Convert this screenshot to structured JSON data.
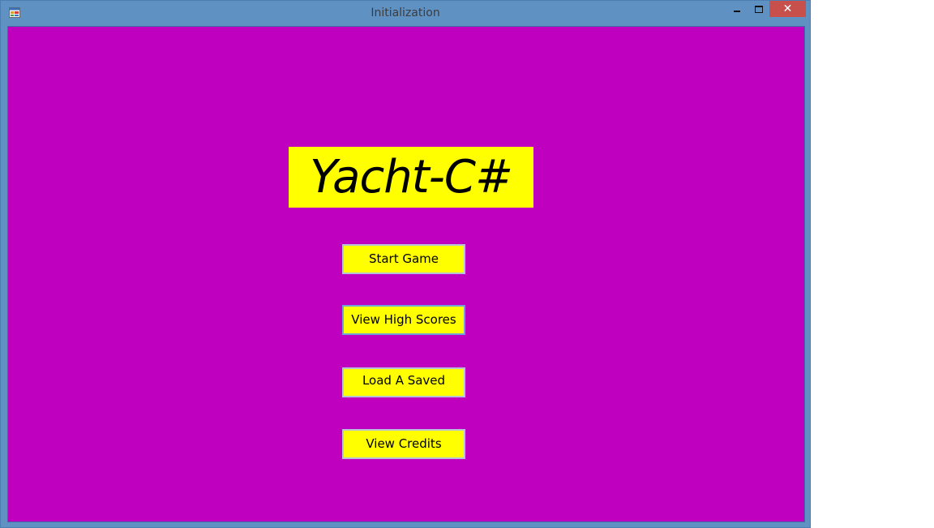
{
  "window": {
    "title": "Initialization",
    "icon": "app-icon",
    "caption_buttons": {
      "minimize_icon": "minimize-icon",
      "maximize_icon": "maximize-icon",
      "close_glyph": "✕"
    },
    "colors": {
      "frame": "#5f91c3",
      "close_button": "#c7504d"
    }
  },
  "main": {
    "background_color": "#bf00bf",
    "accent_color": "#ffff00",
    "game_title": "Yacht-C#",
    "menu": {
      "start_game": "Start Game",
      "view_high_scores": "View High Scores",
      "load_saved": "Load A Saved",
      "view_credits": "View Credits"
    }
  }
}
